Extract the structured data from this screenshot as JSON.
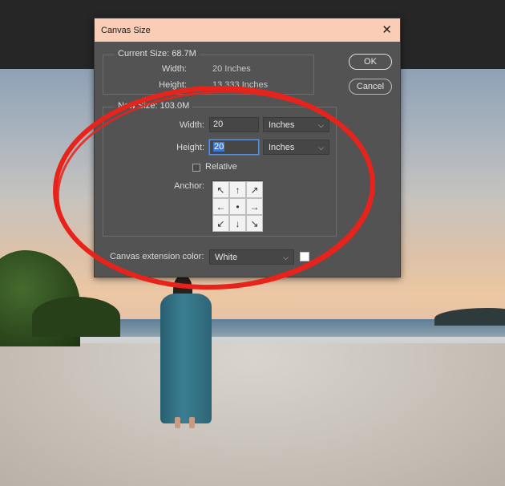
{
  "dialog": {
    "title": "Canvas Size",
    "close_glyph": "✕",
    "current_size": {
      "label": "Current Size: 68.7M",
      "width_label": "Width:",
      "width_value": "20 Inches",
      "height_label": "Height:",
      "height_value": "13.333 Inches"
    },
    "new_size": {
      "label": "New Size: 103.0M",
      "width_label": "Width:",
      "width_value": "20",
      "width_unit": "Inches",
      "height_label": "Height:",
      "height_value": "20",
      "height_unit": "Inches",
      "relative_label": "Relative",
      "relative_checked": false,
      "anchor_label": "Anchor:",
      "anchor_arrows": [
        "↖",
        "↑",
        "↗",
        "←",
        "•",
        "→",
        "↙",
        "↓",
        "↘"
      ]
    },
    "extension": {
      "label": "Canvas extension color:",
      "value": "White",
      "swatch_color": "#ffffff"
    },
    "ok_label": "OK",
    "cancel_label": "Cancel"
  },
  "colors": {
    "dialog_bg": "#535353",
    "title_bar": "#f9cdb6",
    "annotation": "#e8231b"
  }
}
